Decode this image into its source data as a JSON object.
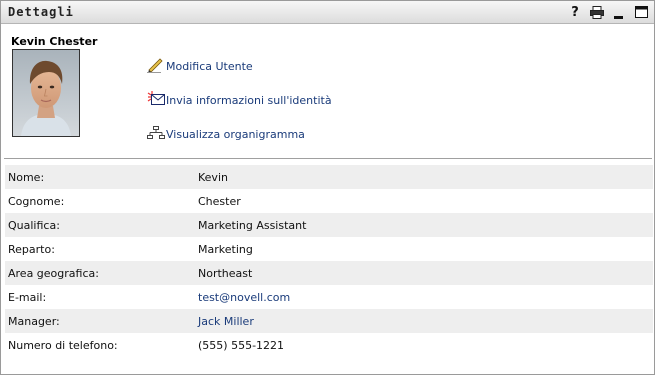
{
  "window": {
    "title": "Dettagli",
    "icons": [
      "help-icon",
      "print-icon",
      "minimize-icon",
      "maximize-icon"
    ]
  },
  "profile": {
    "name": "Kevin Chester",
    "actions": [
      {
        "label": "Modifica Utente",
        "icon": "edit-pencil-icon"
      },
      {
        "label": "Invia informazioni sull'identità",
        "icon": "email-icon"
      },
      {
        "label": "Visualizza organigramma",
        "icon": "org-chart-icon"
      }
    ]
  },
  "details": {
    "rows": [
      {
        "label": "Nome:",
        "value": "Kevin"
      },
      {
        "label": "Cognome:",
        "value": "Chester"
      },
      {
        "label": "Qualifica:",
        "value": "Marketing Assistant"
      },
      {
        "label": "Reparto:",
        "value": "Marketing"
      },
      {
        "label": "Area geografica:",
        "value": "Northeast"
      },
      {
        "label": "E-mail:",
        "value": "test@novell.com"
      },
      {
        "label": "Manager:",
        "value": "Jack Miller"
      },
      {
        "label": "Numero di telefono:",
        "value": "(555) 555-1221"
      }
    ]
  },
  "colors": {
    "link": "#1a3b7a",
    "row_shade": "#eeeeee",
    "titlebar": "#dcdcdc"
  }
}
